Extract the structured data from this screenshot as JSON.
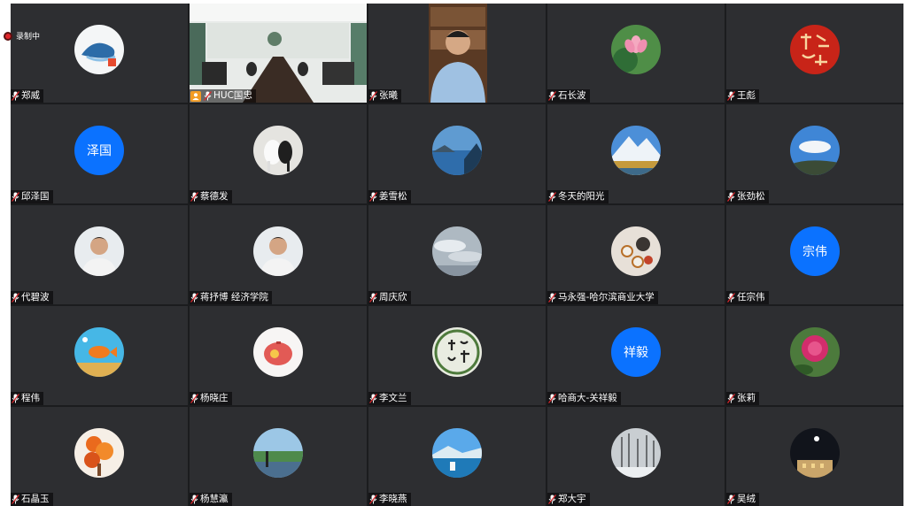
{
  "recording": {
    "label": "录制中"
  },
  "participants": [
    {
      "name": "郑威",
      "avatar": "whale-logo-icon"
    },
    {
      "name": "HUC国忠",
      "video": "conference-room-video",
      "host": true
    },
    {
      "name": "张曦",
      "video": "man-at-desk-video"
    },
    {
      "name": "石长波",
      "avatar": "lotus-flower-icon"
    },
    {
      "name": "王彪",
      "avatar": "red-calligraphy-seal-icon"
    },
    {
      "name": "邱泽国",
      "avatar_text": "泽国"
    },
    {
      "name": "蔡德发",
      "avatar": "horses-icon"
    },
    {
      "name": "姜雪松",
      "avatar": "lake-landscape-icon"
    },
    {
      "name": "冬天的阳光",
      "avatar": "snow-mountain-icon"
    },
    {
      "name": "张劲松",
      "avatar": "sky-clouds-icon"
    },
    {
      "name": "代碧波",
      "avatar": "man-portrait-icon"
    },
    {
      "name": "蒋抒博 经济学院",
      "avatar": "man-portrait-icon"
    },
    {
      "name": "周庆欣",
      "avatar": "cloudy-sky-icon"
    },
    {
      "name": "马永强-哈尔滨商业大学",
      "avatar": "tea-set-icon"
    },
    {
      "name": "任宗伟",
      "avatar_text": "宗伟"
    },
    {
      "name": "程伟",
      "avatar": "aquarium-fish-icon"
    },
    {
      "name": "杨晓庄",
      "avatar": "piggy-bank-icon"
    },
    {
      "name": "李文兰",
      "avatar": "calligraphy-circle-icon"
    },
    {
      "name": "哈商大-关祥毅",
      "avatar_text": "祥毅"
    },
    {
      "name": "张莉",
      "avatar": "peony-flower-icon"
    },
    {
      "name": "石晶玉",
      "avatar": "orange-flowers-icon"
    },
    {
      "name": "杨慧瀛",
      "avatar": "riverside-person-icon"
    },
    {
      "name": "李晓燕",
      "avatar": "blue-lake-icon"
    },
    {
      "name": "郑大宇",
      "avatar": "winter-trees-icon"
    },
    {
      "name": "吴绒",
      "avatar": "night-building-icon"
    }
  ],
  "colors": {
    "grid_bg": "#1b1c1e",
    "tile_bg": "#2d2e31",
    "text_avatar_bg": "#0b72ff",
    "rec_dot": "#e0262b"
  }
}
